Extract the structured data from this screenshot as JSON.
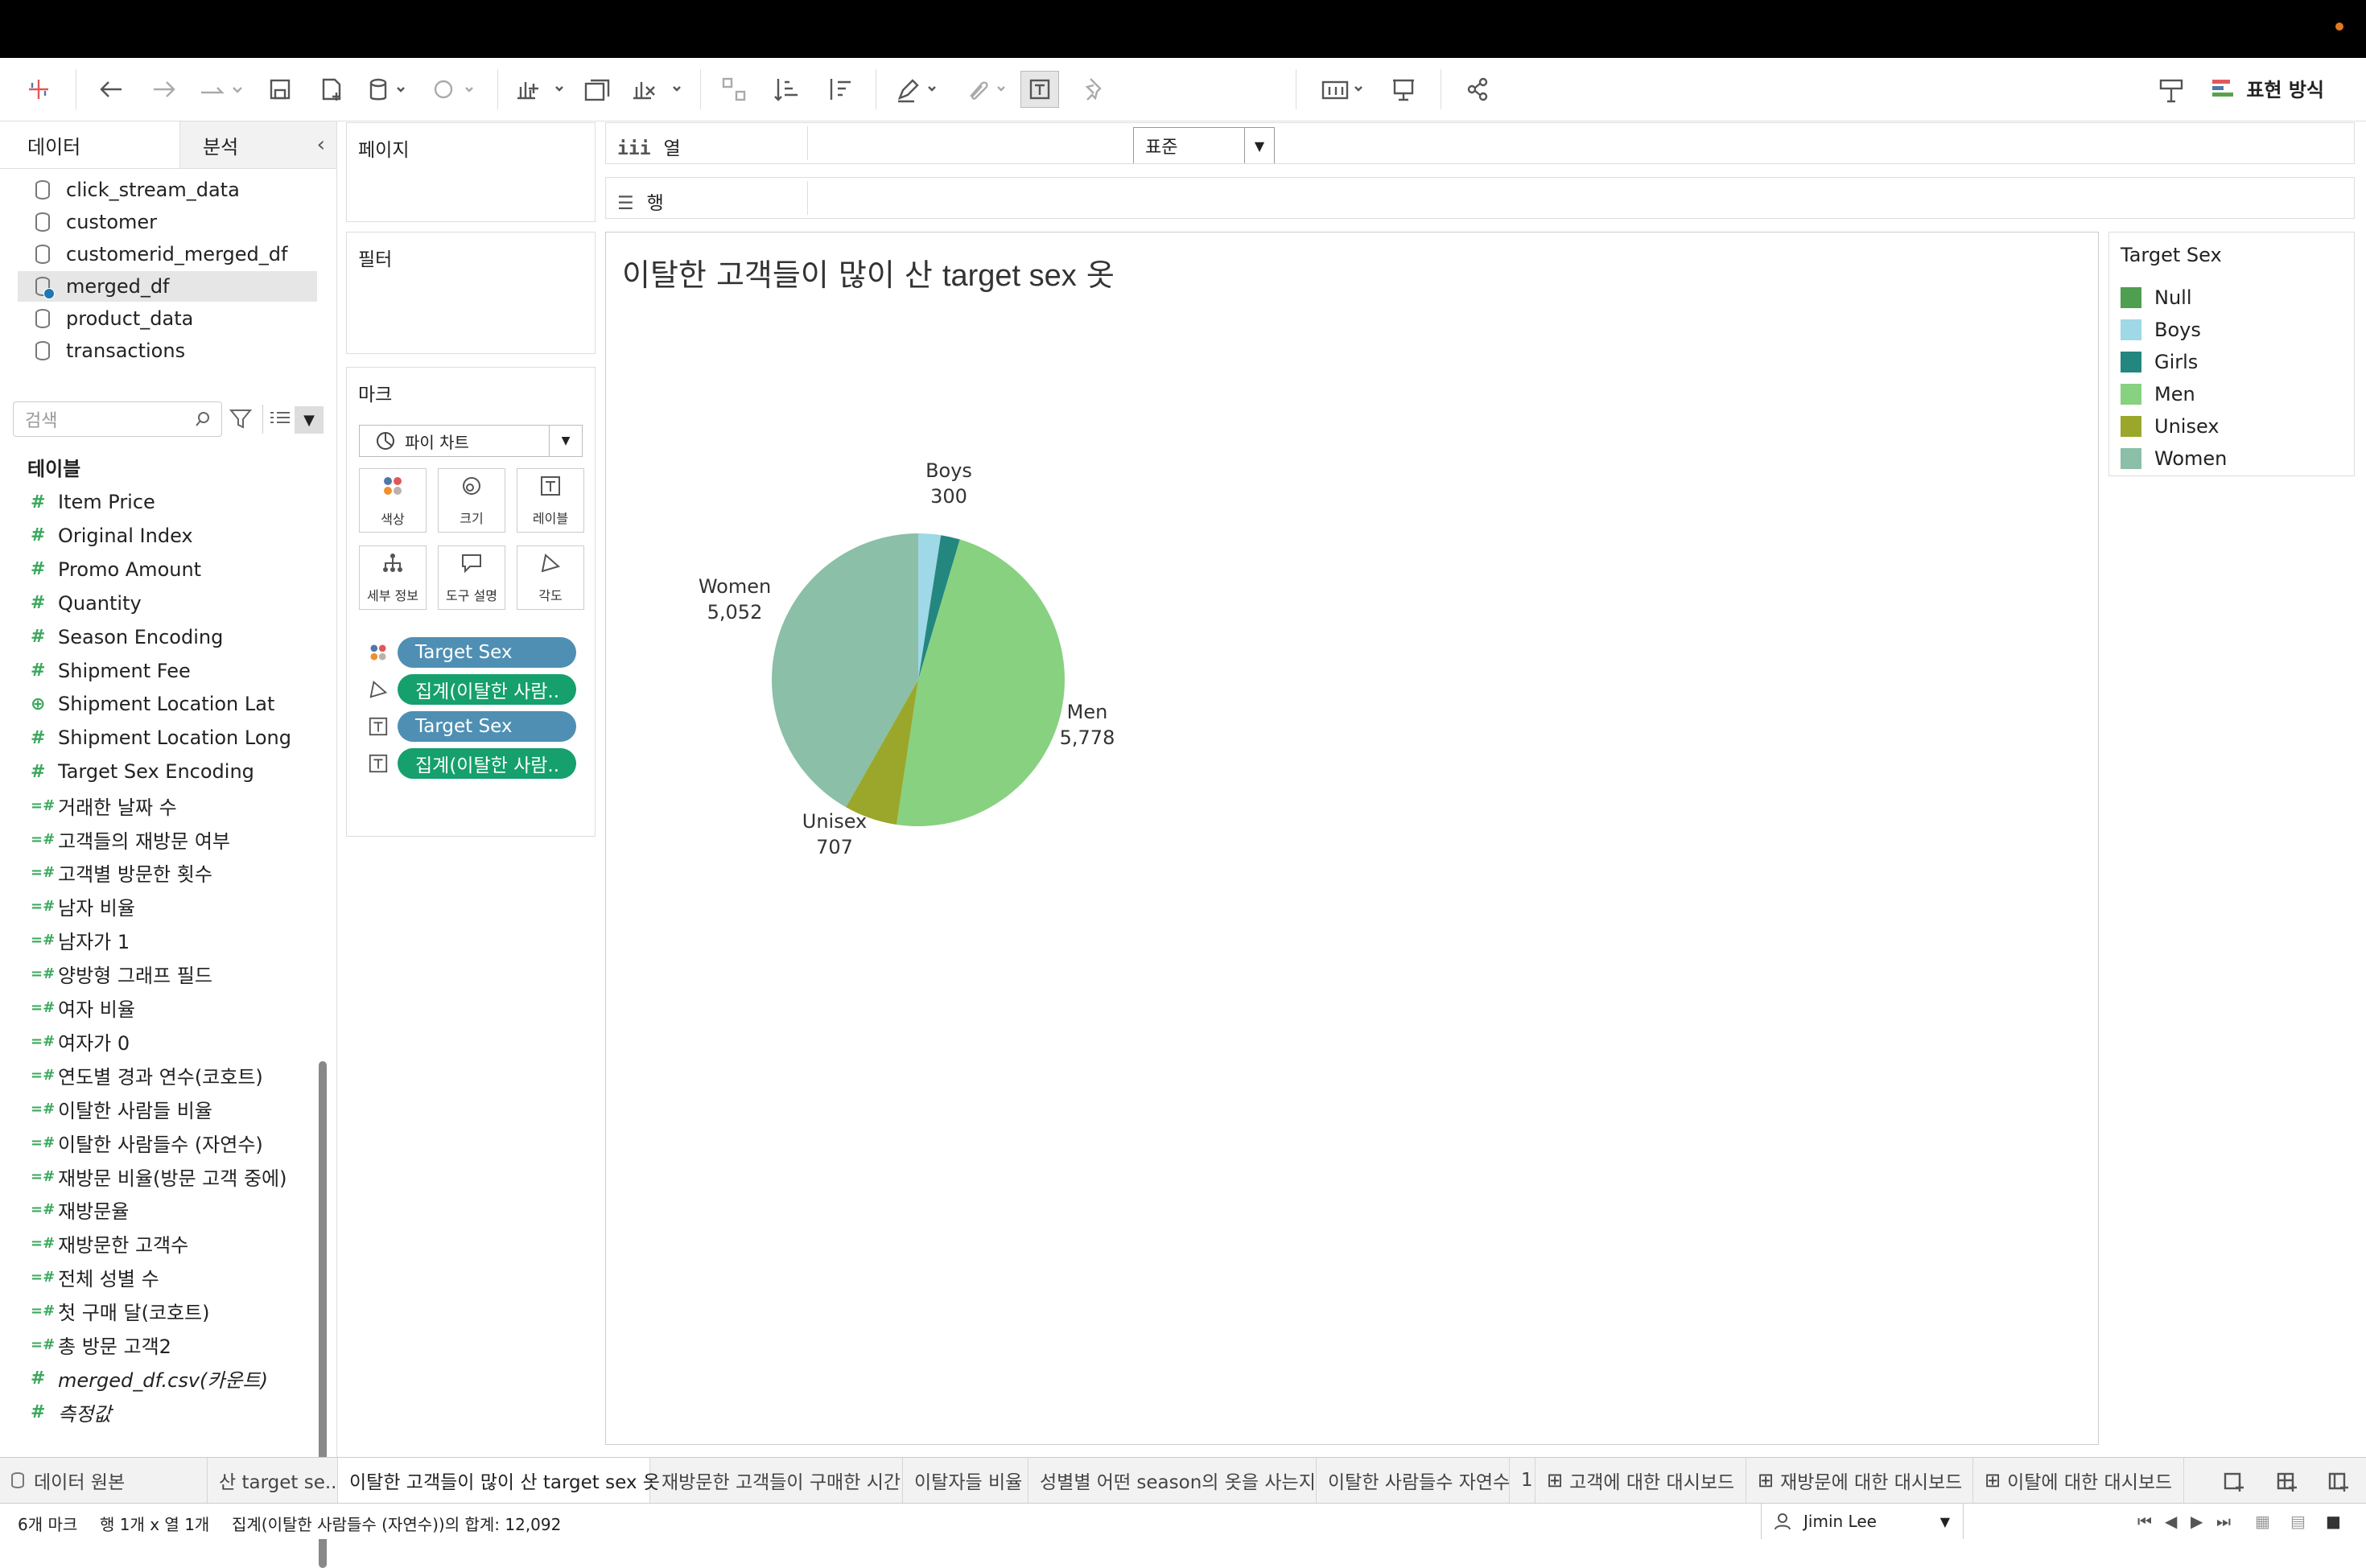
{
  "toolbar": {
    "zoom_select": "표준",
    "show_me": "표현 방식"
  },
  "left_pane": {
    "tabs": [
      "데이터",
      "분석"
    ],
    "datasources": [
      {
        "name": "click_stream_data"
      },
      {
        "name": "customer"
      },
      {
        "name": "customerid_merged_df"
      },
      {
        "name": "merged_df"
      },
      {
        "name": "product_data"
      },
      {
        "name": "transactions"
      }
    ],
    "selected_datasource": "merged_df",
    "search_placeholder": "검색",
    "table_heading": "테이블",
    "fields": [
      {
        "name": "Item Price",
        "type": "measure"
      },
      {
        "name": "Original Index",
        "type": "measure"
      },
      {
        "name": "Promo Amount",
        "type": "measure"
      },
      {
        "name": "Quantity",
        "type": "measure"
      },
      {
        "name": "Season Encoding",
        "type": "measure"
      },
      {
        "name": "Shipment Fee",
        "type": "measure"
      },
      {
        "name": "Shipment Location Lat",
        "type": "geo"
      },
      {
        "name": "Shipment Location Long",
        "type": "measure"
      },
      {
        "name": "Target Sex Encoding",
        "type": "measure"
      },
      {
        "name": "거래한 날짜 수",
        "type": "calc"
      },
      {
        "name": "고객들의 재방문 여부",
        "type": "calc"
      },
      {
        "name": "고객별 방문한 횟수",
        "type": "calc"
      },
      {
        "name": "남자 비율",
        "type": "calc"
      },
      {
        "name": "남자가 1",
        "type": "calc"
      },
      {
        "name": "양방형 그래프 필드",
        "type": "calc"
      },
      {
        "name": "여자 비율",
        "type": "calc"
      },
      {
        "name": "여자가 0",
        "type": "calc"
      },
      {
        "name": "연도별 경과 연수(코호트)",
        "type": "calc"
      },
      {
        "name": "이탈한 사람들 비율",
        "type": "calc"
      },
      {
        "name": "이탈한 사람들수 (자연수)",
        "type": "calc"
      },
      {
        "name": "재방문 비율(방문 고객 중에)",
        "type": "calc"
      },
      {
        "name": "재방문율",
        "type": "calc"
      },
      {
        "name": "재방문한 고객수",
        "type": "calc"
      },
      {
        "name": "전체 성별 수",
        "type": "calc"
      },
      {
        "name": "첫 구매 달(코호트)",
        "type": "calc"
      },
      {
        "name": "총 방문 고객2",
        "type": "calc"
      },
      {
        "name": "merged_df.csv(카운트)",
        "type": "measure-italic"
      },
      {
        "name": "측정값",
        "type": "measure-italic"
      }
    ]
  },
  "shelves": {
    "pages": "페이지",
    "filters": "필터",
    "marks": "마크",
    "mark_type": "파이 차트",
    "mark_buttons": [
      "색상",
      "크기",
      "레이블",
      "세부 정보",
      "도구 설명",
      "각도"
    ],
    "mark_pills": [
      {
        "label": "Target Sex",
        "color": "blue",
        "icon": "color"
      },
      {
        "label": "집계(이탈한 사람..",
        "color": "green",
        "icon": "angle"
      },
      {
        "label": "Target Sex",
        "color": "blue",
        "icon": "label"
      },
      {
        "label": "집계(이탈한 사람..",
        "color": "green",
        "icon": "label"
      }
    ],
    "columns": "열",
    "rows": "행"
  },
  "view": {
    "title_korean": "이탈한 고객들이 많이 산",
    "title_latin": "target sex",
    "title_suffix": "옷"
  },
  "chart_data": {
    "type": "pie",
    "title": "이탈한 고객들이 많이 산 target sex 옷",
    "slices": [
      {
        "name": "Null",
        "value": 0,
        "color": "#4e9f50"
      },
      {
        "name": "Boys",
        "value": 300,
        "color": "#9fd8e6",
        "label": "Boys",
        "value_label": "300"
      },
      {
        "name": "Girls",
        "value": 255,
        "color": "#23877f"
      },
      {
        "name": "Men",
        "value": 5778,
        "color": "#87d180",
        "label": "Men",
        "value_label": "5,778"
      },
      {
        "name": "Unisex",
        "value": 707,
        "color": "#9aa72b",
        "label": "Unisex",
        "value_label": "707"
      },
      {
        "name": "Women",
        "value": 5052,
        "color": "#8bbfa8",
        "label": "Women",
        "value_label": "5,052"
      }
    ]
  },
  "legend": {
    "title": "Target Sex",
    "items": [
      {
        "name": "Null",
        "color": "#4e9f50"
      },
      {
        "name": "Boys",
        "color": "#9fd8e6"
      },
      {
        "name": "Girls",
        "color": "#23877f"
      },
      {
        "name": "Men",
        "color": "#87d180"
      },
      {
        "name": "Unisex",
        "color": "#9aa72b"
      },
      {
        "name": "Women",
        "color": "#8bbfa8"
      }
    ]
  },
  "sheet_tabs": [
    {
      "label": "데이터 원본",
      "icon": "datasource"
    },
    {
      "label": "산 target se...",
      "icon": ""
    },
    {
      "label": "이탈한 고객들이 많이 산 target sex 옷",
      "icon": "",
      "active": true
    },
    {
      "label": "재방문한 고객들이 구매한 시간",
      "icon": ""
    },
    {
      "label": "이탈자들 비율",
      "icon": ""
    },
    {
      "label": "성별별 어떤 season의 옷을 사는지",
      "icon": ""
    },
    {
      "label": "이탈한 사람들수 자연수",
      "icon": ""
    },
    {
      "label": "1",
      "icon": ""
    },
    {
      "label": "고객에 대한 대시보드",
      "icon": "dashboard"
    },
    {
      "label": "재방문에 대한 대시보드",
      "icon": "dashboard"
    },
    {
      "label": "이탈에 대한 대시보드",
      "icon": "dashboard"
    }
  ],
  "status": {
    "marks": "6개 마크",
    "rows_cols": "행 1개 x 열 1개",
    "sum": "집계(이탈한 사람들수 (자연수))의 합계: 12,092",
    "user": "Jimin Lee"
  }
}
